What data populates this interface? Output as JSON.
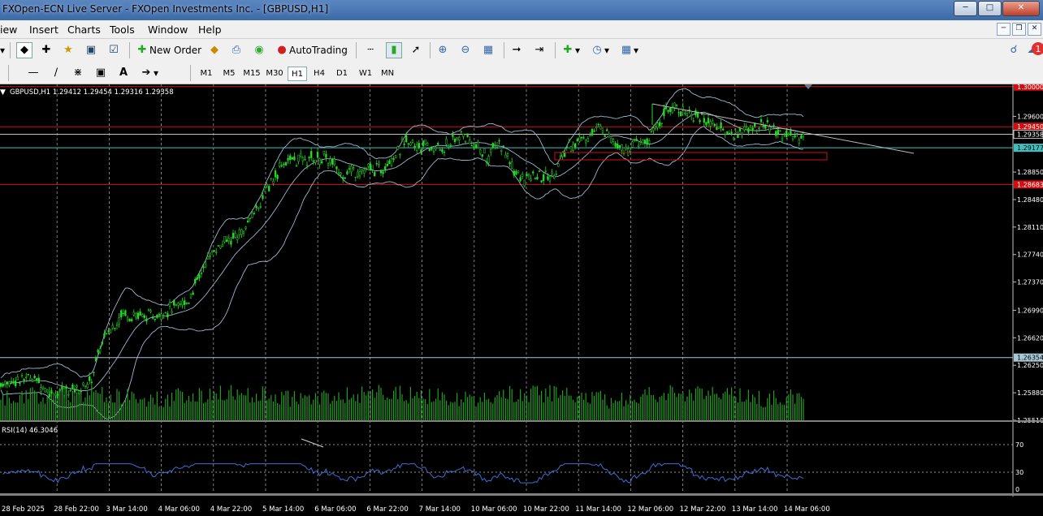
{
  "window": {
    "title": "FXOpen-ECN Live Server - FXOpen Investments Inc. - [GBPUSD,H1]"
  },
  "menu": [
    "iew",
    "Insert",
    "Charts",
    "Tools",
    "Window",
    "Help"
  ],
  "toolbar": {
    "new_order": "New Order",
    "autotrading": "AutoTrading"
  },
  "timeframes": [
    "M1",
    "M5",
    "M15",
    "M30",
    "H1",
    "H4",
    "D1",
    "W1",
    "MN"
  ],
  "active_timeframe": "H1",
  "notification_count": "1",
  "chart": {
    "header": "GBPUSD,H1  1.29412 1.29454 1.29316 1.29358",
    "symbol": "GBPUSD",
    "timeframe": "H1",
    "ohlc": {
      "open": 1.29412,
      "high": 1.29454,
      "low": 1.29316,
      "close": 1.29358
    },
    "rsi_label": "RSI(14) 46.3046",
    "rsi_value": 46.3046,
    "price_ticks": [
      "1.29600",
      "1.28850",
      "1.28480",
      "1.28110",
      "1.27740",
      "1.27370",
      "1.26990",
      "1.26620",
      "1.26250",
      "1.25880",
      "1.25510"
    ],
    "price_range": [
      1.2551,
      1.3003
    ],
    "rsi_ticks": [
      "70",
      "30",
      "0"
    ],
    "time_labels": [
      "28 Feb 2025",
      "28 Feb 22:00",
      "3 Mar 14:00",
      "4 Mar 06:00",
      "4 Mar 22:00",
      "5 Mar 14:00",
      "6 Mar 06:00",
      "6 Mar 22:00",
      "7 Mar 14:00",
      "10 Mar 06:00",
      "10 Mar 22:00",
      "11 Mar 14:00",
      "12 Mar 06:00",
      "12 Mar 22:00",
      "13 Mar 14:00",
      "14 Mar 06:00"
    ],
    "horizontal_lines": [
      {
        "price": 1.3,
        "label": "1.30000",
        "color": "#d01010"
      },
      {
        "price": 1.2946,
        "label": "1.29450",
        "color": "#d01010"
      },
      {
        "price": 1.29358,
        "label": "1.29358",
        "color": "#c0c0c0"
      },
      {
        "price": 1.29177,
        "label": "1.29177",
        "color": "#3fbfbf"
      },
      {
        "price": 1.28683,
        "label": "1.28683",
        "color": "#d01010"
      },
      {
        "price": 1.26354,
        "label": "1.26354",
        "color": "#a8c8d8"
      }
    ]
  },
  "colors": {
    "candles": "#22dd22",
    "bands": "#9bb8d0",
    "rsi": "#3d6fd6",
    "volume": "#1fa11f",
    "level": "#d01010"
  }
}
